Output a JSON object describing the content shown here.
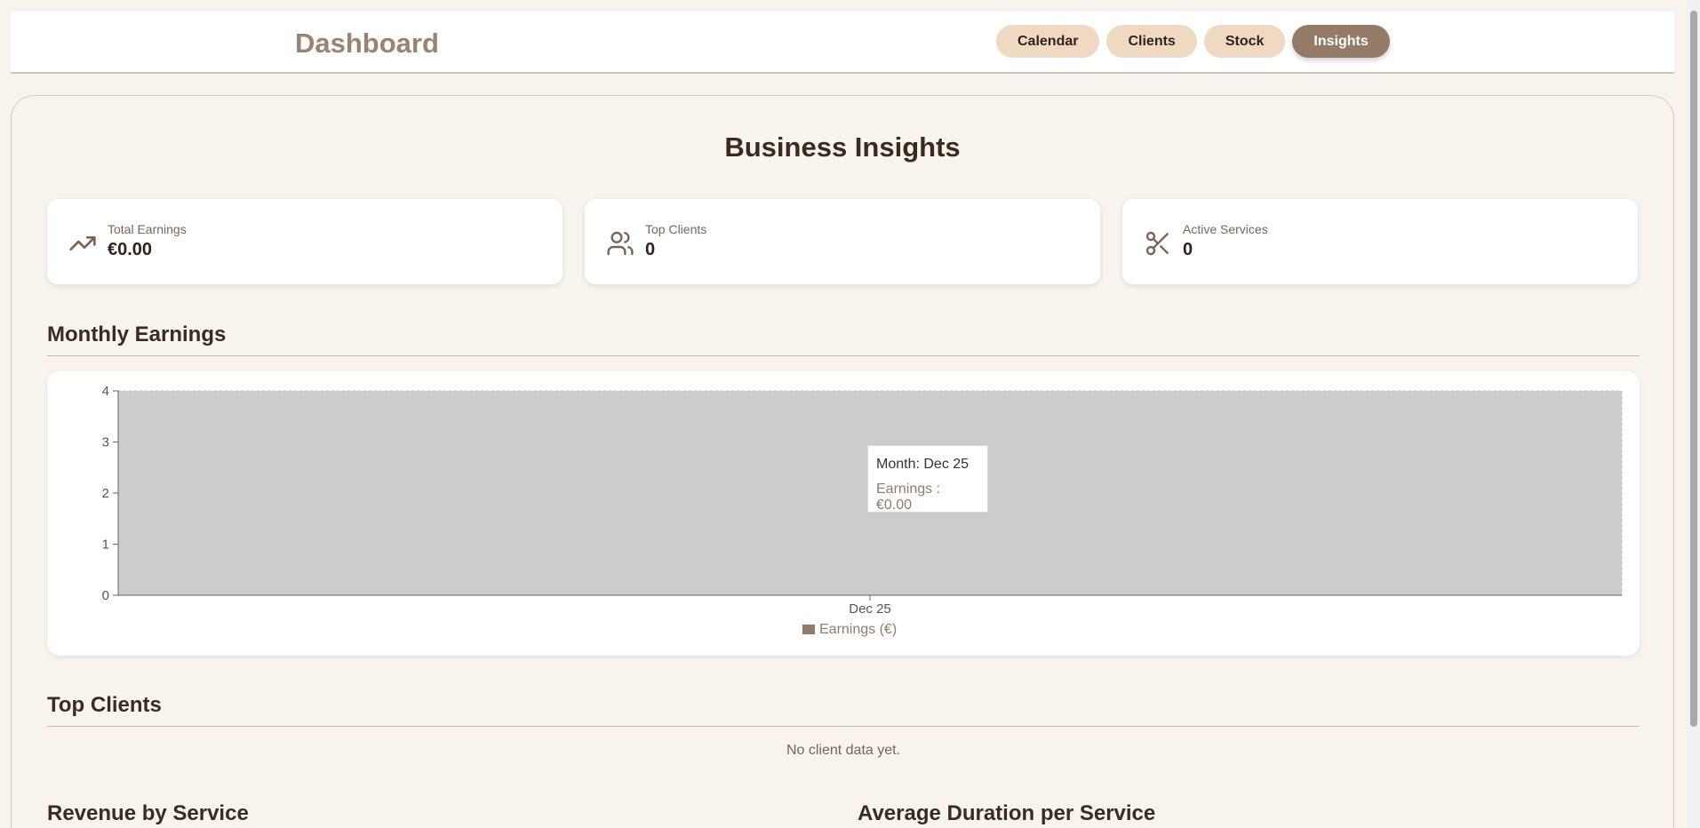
{
  "header": {
    "brand": "Dashboard",
    "nav": [
      {
        "label": "Calendar",
        "active": false
      },
      {
        "label": "Clients",
        "active": false
      },
      {
        "label": "Stock",
        "active": false
      },
      {
        "label": "Insights",
        "active": true
      }
    ]
  },
  "main": {
    "title": "Business Insights",
    "stats": [
      {
        "label": "Total Earnings",
        "value": "€0.00",
        "icon": "trending-up-icon"
      },
      {
        "label": "Top Clients",
        "value": "0",
        "icon": "users-icon"
      },
      {
        "label": "Active Services",
        "value": "0",
        "icon": "scissors-icon"
      }
    ],
    "sections": {
      "monthly_earnings": "Monthly Earnings",
      "top_clients": "Top Clients",
      "revenue_by_service": "Revenue by Service",
      "avg_duration": "Average Duration per Service"
    },
    "top_clients_empty": "No client data yet."
  },
  "chart_data": {
    "type": "bar",
    "categories": [
      "Dec 25"
    ],
    "series": [
      {
        "name": "Earnings (€)",
        "values": [
          0
        ]
      }
    ],
    "ylim": [
      0,
      4
    ],
    "yticks": [
      "0",
      "1",
      "2",
      "3",
      "4"
    ],
    "x_tick_visible_text": "Dec 2",
    "legend": "bottom",
    "tooltip": {
      "line1": "Month: Dec 25",
      "line2": "Earnings : €0.00"
    }
  },
  "colors": {
    "accent": "#937b67",
    "nav_pill": "#efd9c0",
    "brand": "#9a8370",
    "chart_hover_band": "#cccccc"
  }
}
